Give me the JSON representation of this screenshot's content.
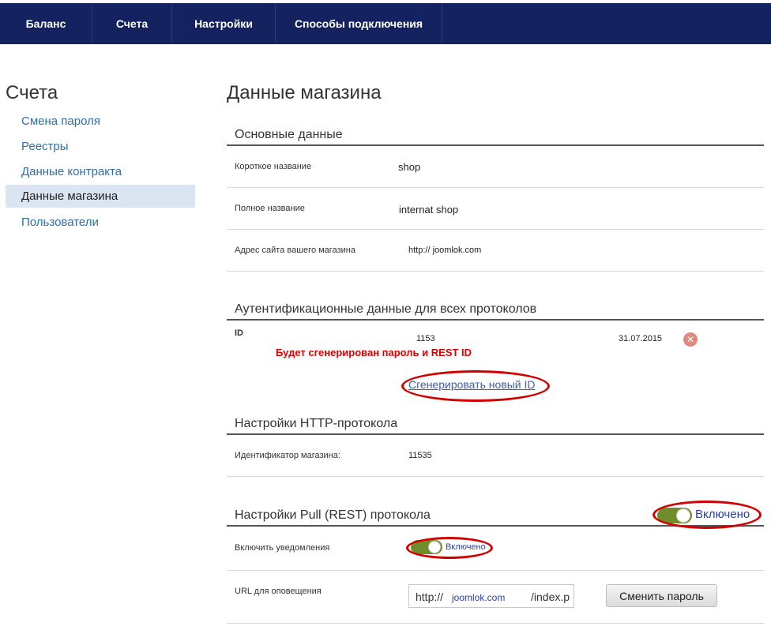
{
  "topnav": {
    "items": [
      "Баланс",
      "Счета",
      "Настройки",
      "Способы подключения"
    ]
  },
  "sidebar": {
    "title": "Счета",
    "items": [
      "Смена пароля",
      "Реестры",
      "Данные контракта",
      "Данные магазина",
      "Пользователи"
    ],
    "active": "Данные магазина"
  },
  "page": {
    "title": "Данные магазина"
  },
  "basic": {
    "title": "Основные данные",
    "short_name_label": "Короткое название",
    "short_name_value": "shop",
    "full_name_label": "Полное название",
    "full_name_value": "internat shop",
    "site_label": "Адрес сайта вашего магазина",
    "site_value": "http:// joomlok.com"
  },
  "auth": {
    "title": "Аутентификационные данные для всех протоколов",
    "id_label": "ID",
    "id_value": "1153",
    "date": "31.07.2015",
    "annotation": "Будет сгенерирован пароль и REST ID",
    "generate_link": "Сгенерировать новый ID"
  },
  "http": {
    "title": "Настройки HTTP-протокола",
    "shop_id_label": "Идентификатор магазина:",
    "shop_id_value": "11535"
  },
  "pull": {
    "title": "Настройки Pull (REST) протокола",
    "toggle_label": "Включено",
    "notify_label": "Включить уведомления",
    "notify_toggle_label": "Включено",
    "url_label": "URL для оповещения",
    "url_part1": "http://",
    "url_part2": "joomlok.com",
    "url_part3": "/index.p",
    "change_password_button": "Сменить пароль"
  },
  "colors": {
    "nav_bg": "#14235f",
    "annotation_red": "#e10000",
    "toggle_green": "#6f8e2b",
    "link_blue": "#2f6ea8"
  }
}
